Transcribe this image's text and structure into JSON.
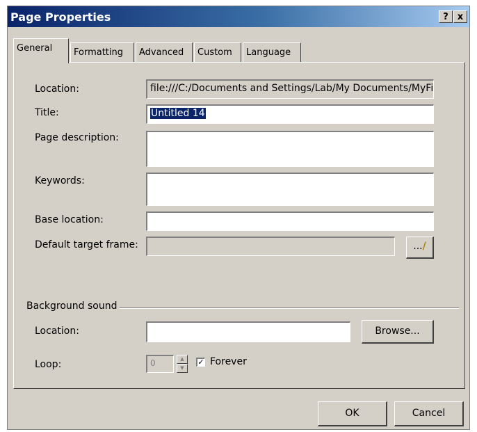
{
  "window": {
    "title": "Page Properties",
    "help_label": "?",
    "close_label": "x"
  },
  "tabs": [
    {
      "label": "General",
      "active": true
    },
    {
      "label": "Formatting",
      "active": false
    },
    {
      "label": "Advanced",
      "active": false
    },
    {
      "label": "Custom",
      "active": false
    },
    {
      "label": "Language",
      "active": false
    }
  ],
  "general": {
    "location_label": "Location:",
    "location_value": "file:///C:/Documents and Settings/Lab/My Documents/MyFi",
    "title_label": "Title:",
    "title_value": "Untitled 14",
    "page_description_label": "Page description:",
    "page_description_value": "",
    "keywords_label": "Keywords:",
    "keywords_value": "",
    "base_location_label": "Base location:",
    "base_location_value": "",
    "default_target_frame_label": "Default target frame:",
    "default_target_frame_value": "",
    "target_frame_button_label": "..."
  },
  "background_sound": {
    "group_label": "Background sound",
    "location_label": "Location:",
    "location_value": "",
    "browse_label": "Browse...",
    "loop_label": "Loop:",
    "loop_value": "0",
    "forever_label": "Forever",
    "forever_checked": true
  },
  "footer": {
    "ok_label": "OK",
    "cancel_label": "Cancel"
  },
  "icons": {
    "edit_frame": "pencil-icon",
    "checkmark": "check-icon"
  }
}
